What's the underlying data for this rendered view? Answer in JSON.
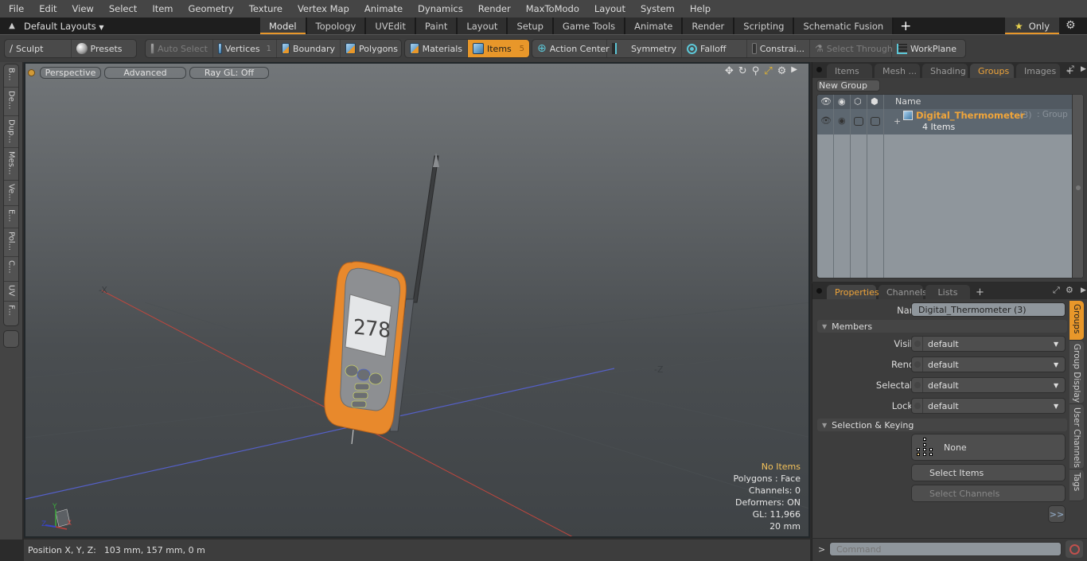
{
  "menubar": {
    "items": [
      "File",
      "Edit",
      "View",
      "Select",
      "Item",
      "Geometry",
      "Texture",
      "Vertex Map",
      "Animate",
      "Dynamics",
      "Render",
      "MaxToModo",
      "Layout",
      "System",
      "Help"
    ]
  },
  "layoutbar": {
    "layouts_label": "Default Layouts",
    "tabs": [
      {
        "label": "Model",
        "active": true
      },
      {
        "label": "Topology"
      },
      {
        "label": "UVEdit"
      },
      {
        "label": "Paint"
      },
      {
        "label": "Layout"
      },
      {
        "label": "Setup"
      },
      {
        "label": "Game Tools"
      },
      {
        "label": "Animate"
      },
      {
        "label": "Render"
      },
      {
        "label": "Scripting"
      },
      {
        "label": "Schematic Fusion"
      }
    ],
    "add_tab": "+",
    "only_label": "Only"
  },
  "toolbar": {
    "sculpt": "Sculpt",
    "presets": "Presets",
    "auto_select": "Auto Select",
    "vertices": "Vertices",
    "vertices_count": "1",
    "boundary": "Boundary",
    "polygons": "Polygons",
    "materials": "Materials",
    "items": "Items",
    "items_count": "5",
    "action_center": "Action Center",
    "symmetry": "Symmetry",
    "falloff": "Falloff",
    "constraints": "Constrai...",
    "select_through": "Select Through",
    "workplane": "WorkPlane"
  },
  "left_tabs": [
    "B...",
    "De...",
    "Dup...",
    "Mes...",
    "Ve...",
    "E...",
    "Pol...",
    "C...",
    "UV",
    "F..."
  ],
  "viewport": {
    "view_mode": "Perspective",
    "shading": "Advanced",
    "raygl": "Ray GL: Off",
    "axis_labels": {
      "neg_x": "-X",
      "neg_z": "-Z"
    },
    "display_reading": "278",
    "info": {
      "selection": "No Items",
      "polygons": "Polygons : Face",
      "channels": "Channels: 0",
      "deformers": "Deformers: ON",
      "gl": "GL: 11,966",
      "scale": "20 mm"
    },
    "gizmo": {
      "x": "X",
      "y": "Y",
      "z": "Z"
    }
  },
  "statusbar": {
    "label": "Position X, Y, Z:",
    "value": "103 mm, 157 mm, 0 m"
  },
  "groups_panel": {
    "tabs": [
      {
        "label": "Items"
      },
      {
        "label": "Mesh ..."
      },
      {
        "label": "Shading"
      },
      {
        "label": "Groups",
        "active": true
      },
      {
        "label": "Images"
      }
    ],
    "new_group": "New Group",
    "column_name": "Name",
    "rows": [
      {
        "name": "Digital_Thermometer",
        "count": "(3)",
        "type": ": Group",
        "sub": "4 Items"
      }
    ]
  },
  "properties_panel": {
    "tabs": [
      {
        "label": "Properties",
        "active": true
      },
      {
        "label": "Channels"
      },
      {
        "label": "Lists"
      }
    ],
    "name_label": "Name",
    "name_value": "Digital_Thermometer (3)",
    "members_section": "Members",
    "fields": [
      {
        "label": "Visible",
        "value": "default"
      },
      {
        "label": "Render",
        "value": "default"
      },
      {
        "label": "Selectable",
        "value": "default"
      },
      {
        "label": "Locked",
        "value": "default"
      }
    ],
    "selection_section": "Selection & Keying",
    "keying_value": "None",
    "select_items": "Select Items",
    "select_channels": "Select Channels",
    "more": ">>",
    "side_tabs": [
      {
        "label": "Groups",
        "active": true
      },
      {
        "label": "Group Display"
      },
      {
        "label": "User Channels"
      },
      {
        "label": "Tags"
      }
    ]
  },
  "command": {
    "prompt": ">",
    "placeholder": "Command"
  },
  "colors": {
    "accent": "#e8972a",
    "group_name": "#f0a53a",
    "info_highlight": "#f4c25a"
  }
}
